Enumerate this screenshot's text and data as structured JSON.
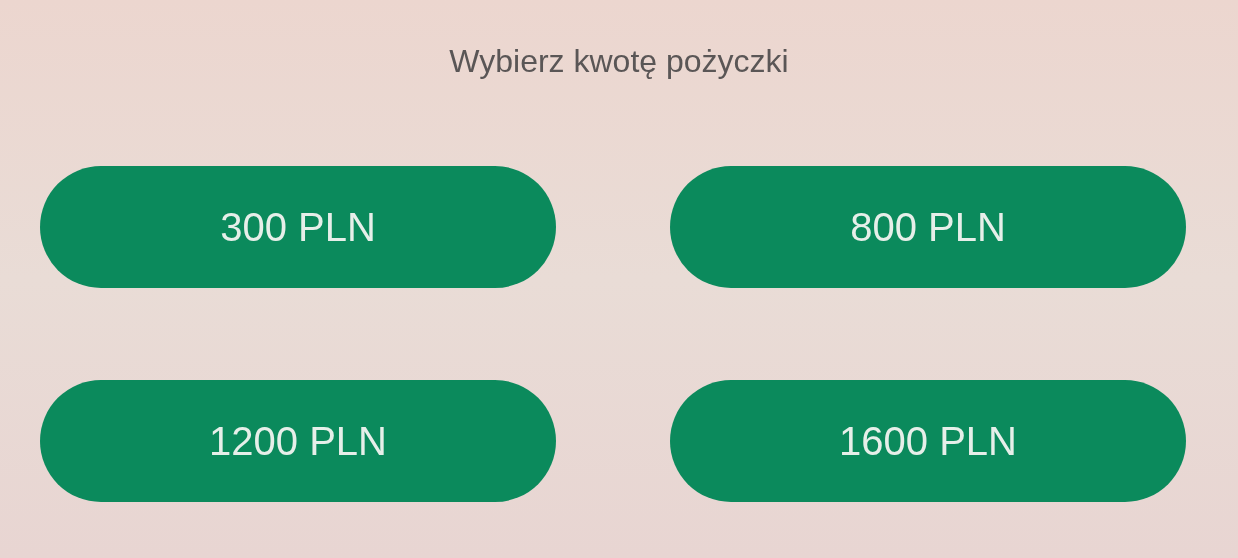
{
  "title": "Wybierz kwotę pożyczki",
  "amounts": [
    "300 PLN",
    "800 PLN",
    "1200 PLN",
    "1600 PLN"
  ]
}
